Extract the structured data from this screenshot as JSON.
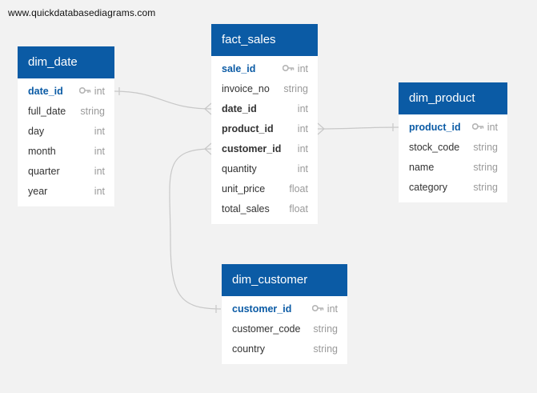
{
  "watermark": "www.quickdatabasediagrams.com",
  "colors": {
    "header": "#0b5ba5",
    "pk_text": "#0b5ba5",
    "type_text": "#9a9a9a",
    "link": "#c8c8c8"
  },
  "tables": {
    "dim_date": {
      "title": "dim_date",
      "columns": [
        {
          "name": "date_id",
          "type": "int"
        },
        {
          "name": "full_date",
          "type": "string"
        },
        {
          "name": "day",
          "type": "int"
        },
        {
          "name": "month",
          "type": "int"
        },
        {
          "name": "quarter",
          "type": "int"
        },
        {
          "name": "year",
          "type": "int"
        }
      ]
    },
    "fact_sales": {
      "title": "fact_sales",
      "columns": [
        {
          "name": "sale_id",
          "type": "int"
        },
        {
          "name": "invoice_no",
          "type": "string"
        },
        {
          "name": "date_id",
          "type": "int"
        },
        {
          "name": "product_id",
          "type": "int"
        },
        {
          "name": "customer_id",
          "type": "int"
        },
        {
          "name": "quantity",
          "type": "int"
        },
        {
          "name": "unit_price",
          "type": "float"
        },
        {
          "name": "total_sales",
          "type": "float"
        }
      ]
    },
    "dim_product": {
      "title": "dim_product",
      "columns": [
        {
          "name": "product_id",
          "type": "int"
        },
        {
          "name": "stock_code",
          "type": "string"
        },
        {
          "name": "name",
          "type": "string"
        },
        {
          "name": "category",
          "type": "string"
        }
      ]
    },
    "dim_customer": {
      "title": "dim_customer",
      "columns": [
        {
          "name": "customer_id",
          "type": "int"
        },
        {
          "name": "customer_code",
          "type": "string"
        },
        {
          "name": "country",
          "type": "string"
        }
      ]
    }
  },
  "icons": {
    "primary_key": "key-icon"
  }
}
